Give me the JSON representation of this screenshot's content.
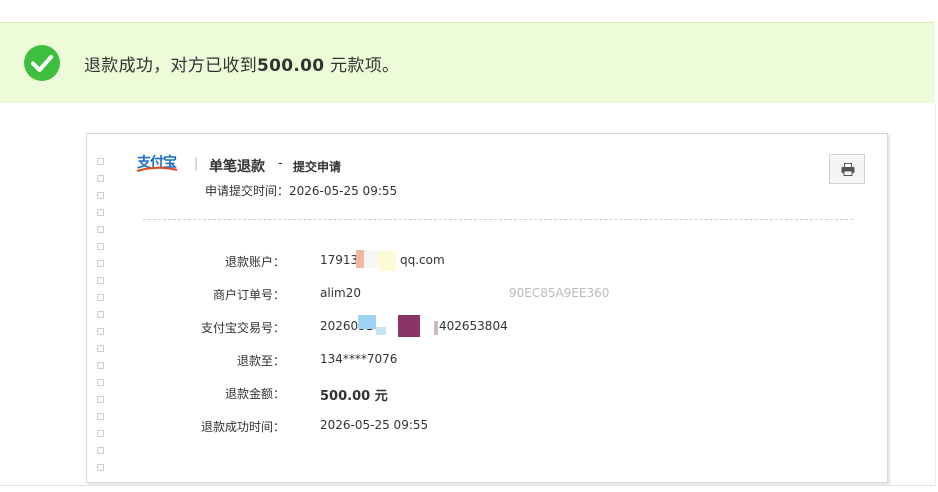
{
  "banner": {
    "message_prefix": "退款成功，对方已收到",
    "amount": "500.00",
    "message_suffix": " 元款项。",
    "accent_color": "#3fbf3f",
    "background_color": "#eefbd9"
  },
  "receipt": {
    "logo_text": "支付宝",
    "separator": "|",
    "title": "单笔退款",
    "dash": "-",
    "subtitle": "提交申请",
    "submit_time": "申请提交时间：2026-05-25 09:55",
    "print_icon": "printer-icon",
    "rows": [
      {
        "label": "退款账户：",
        "value": "17913",
        "value_tail": "qq.com"
      },
      {
        "label": "商户订单号：",
        "value": "alim20",
        "value_tail": "90EC85A9EE360"
      },
      {
        "label": "支付宝交易号：",
        "value": "2026051",
        "value_tail": "402653804"
      },
      {
        "label": "退款至：",
        "value": "134****7076",
        "value_tail": ""
      },
      {
        "label": "退款金额：",
        "value": "500.00 元",
        "value_tail": ""
      },
      {
        "label": "退款成功时间：",
        "value": "2026-05-25 09:55",
        "value_tail": ""
      }
    ]
  }
}
